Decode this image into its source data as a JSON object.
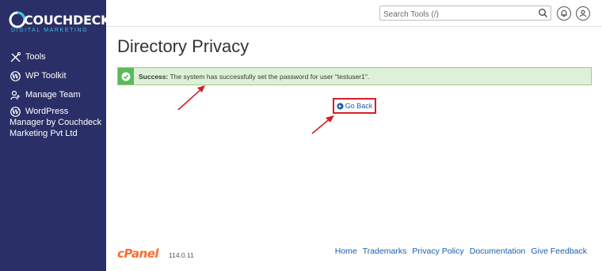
{
  "sidebar": {
    "logo_main": "COUCHDECK",
    "logo_sub": "DIGITAL MARKETING",
    "items": [
      {
        "label": "Tools",
        "icon": "tools-icon"
      },
      {
        "label": "WP Toolkit",
        "icon": "wordpress-icon"
      },
      {
        "label": "Manage Team",
        "icon": "user-add-icon"
      },
      {
        "label": "WordPress Manager by Couchdeck Marketing Pvt Ltd",
        "icon": "wordpress-icon"
      }
    ]
  },
  "header": {
    "search_placeholder": "Search Tools (/)"
  },
  "main": {
    "title": "Directory Privacy",
    "alert_strong": "Success:",
    "alert_text": " The system has successfully set the password for user \"testuser1\".",
    "go_back_label": "Go Back"
  },
  "footer": {
    "brand": "cPanel",
    "version": "114.0.11",
    "links": [
      "Home",
      "Trademarks",
      "Privacy Policy",
      "Documentation",
      "Give Feedback"
    ]
  },
  "colors": {
    "sidebar_bg": "#2b2f67",
    "success_green": "#5cb85c",
    "annotation_red": "#d21f26",
    "link_blue": "#1a5fa8",
    "cpanel_orange": "#ff6c2c"
  }
}
